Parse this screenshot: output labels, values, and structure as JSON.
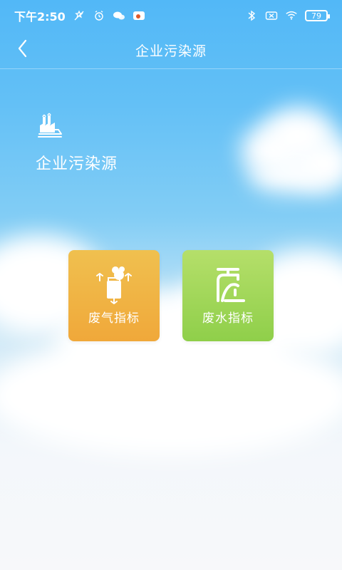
{
  "status_bar": {
    "time": "下午2:50",
    "battery": "79"
  },
  "nav": {
    "title": "企业污染源"
  },
  "section": {
    "title": "企业污染源"
  },
  "tiles": [
    {
      "label": "废气指标",
      "color": "#f0b447"
    },
    {
      "label": "废水指标",
      "color": "#a2d75a"
    }
  ],
  "colors": {
    "sky_top": "#52b8f7",
    "background_bottom": "#f7f8fa",
    "gas_tile": "#f0b447",
    "water_tile": "#a2d75a"
  },
  "icons": {
    "back": "chevron-left-icon",
    "section": "factory-icon",
    "gas": "chimney-smoke-icon",
    "water": "faucet-icon"
  }
}
